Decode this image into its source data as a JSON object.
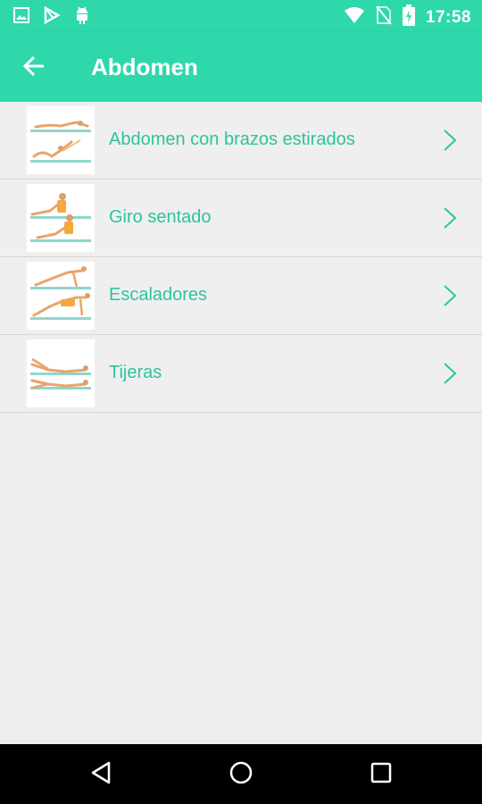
{
  "status_bar": {
    "time": "17:58",
    "left_icons": [
      "image-icon",
      "play-store-icon",
      "android-icon"
    ],
    "right_icons": [
      "wifi-icon",
      "no-sim-icon",
      "battery-charging-icon"
    ]
  },
  "app_bar": {
    "title": "Abdomen",
    "back_icon": "back-arrow-icon"
  },
  "exercises": [
    {
      "label": "Abdomen con brazos estirados",
      "icon": "chevron-right-icon"
    },
    {
      "label": "Giro sentado",
      "icon": "chevron-right-icon"
    },
    {
      "label": "Escaladores",
      "icon": "chevron-right-icon"
    },
    {
      "label": "Tijeras",
      "icon": "chevron-right-icon"
    }
  ],
  "nav_bar": {
    "icons": [
      "back-triangle-icon",
      "home-circle-icon",
      "recents-square-icon"
    ]
  },
  "colors": {
    "accent": "#2ed8ab",
    "label_text": "#2cc49c",
    "background": "#eeeeee"
  }
}
